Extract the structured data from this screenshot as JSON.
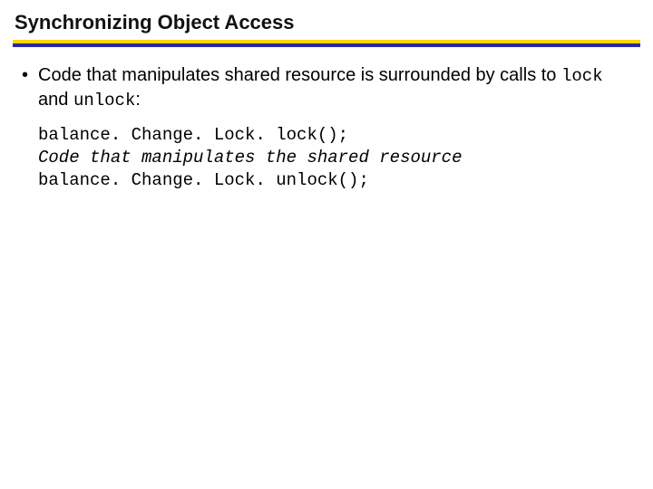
{
  "title": "Synchronizing Object Access",
  "bullet": {
    "pre": "Code that manipulates shared resource is surrounded by calls to ",
    "code1": "lock",
    "mid": " and ",
    "code2": "unlock",
    "post": ":"
  },
  "code": {
    "line1": "balance. Change. Lock. lock();",
    "line2": "Code that manipulates the shared resource",
    "line3": "balance. Change. Lock. unlock();"
  }
}
